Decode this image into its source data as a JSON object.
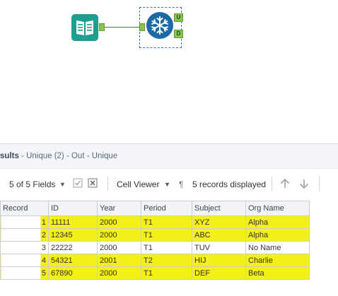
{
  "canvas": {
    "input_tool_icon": "book-icon",
    "unique_tool_icon": "snowflake-icon",
    "anchors": {
      "unique": "U",
      "duplicate": "D"
    }
  },
  "results": {
    "title": "sults",
    "subtitle": " - Unique (2) - Out - Unique"
  },
  "toolbar": {
    "fields_label": "5 of 5 Fields",
    "cell_viewer_label": "Cell Viewer",
    "records_label": "5 records displayed"
  },
  "table": {
    "columns": [
      "Record",
      "ID",
      "Year",
      "Period",
      "Subject",
      "Org Name"
    ],
    "rows": [
      {
        "record": "1",
        "id": "11111",
        "year": "2000",
        "period": "T1",
        "subject": "XYZ",
        "org": "Alpha",
        "highlighted": true
      },
      {
        "record": "2",
        "id": "12345",
        "year": "2000",
        "period": "T1",
        "subject": "ABC",
        "org": "Alpha",
        "highlighted": true
      },
      {
        "record": "3",
        "id": "22222",
        "year": "2000",
        "period": "T1",
        "subject": "TUV",
        "org": "No Name",
        "highlighted": false
      },
      {
        "record": "4",
        "id": "54321",
        "year": "2001",
        "period": "T2",
        "subject": "HIJ",
        "org": "Charlie",
        "highlighted": true
      },
      {
        "record": "5",
        "id": "67890",
        "year": "2000",
        "period": "T1",
        "subject": "DEF",
        "org": "Beta",
        "highlighted": true
      }
    ]
  },
  "colors": {
    "highlight": "#f3ef17",
    "input_tool": "#1e9e8f",
    "unique_tool": "#1b6aa5",
    "anchor": "#8bc34a"
  }
}
